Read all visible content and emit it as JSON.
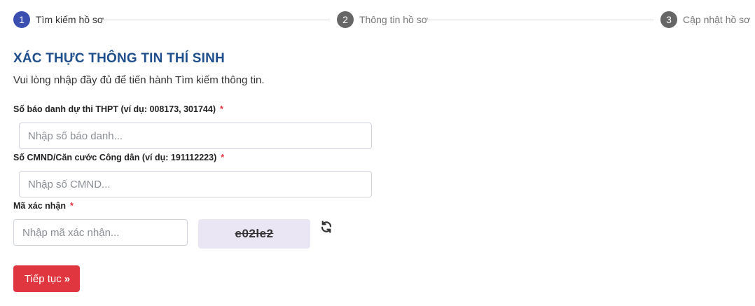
{
  "stepper": {
    "steps": [
      {
        "number": "1",
        "label": "Tìm kiếm hồ sơ"
      },
      {
        "number": "2",
        "label": "Thông tin hồ sơ"
      },
      {
        "number": "3",
        "label": "Cập nhật hồ sơ"
      }
    ],
    "active_color": "#3a4fb0",
    "inactive_color": "#666666"
  },
  "form": {
    "title": "XÁC THỰC THÔNG TIN THÍ SINH",
    "subtitle": "Vui lòng nhập đầy đủ để tiến hành Tìm kiếm thông tin.",
    "sbd": {
      "label": "Số báo danh dự thi THPT (ví dụ: 008173, 301744)",
      "required_mark": "*",
      "placeholder": "Nhập số báo danh..."
    },
    "cmnd": {
      "label": "Số CMND/Căn cước Công dân (ví dụ: 191112223)",
      "required_mark": "*",
      "placeholder": "Nhập số CMND..."
    },
    "captcha": {
      "label": "Mã xác nhận",
      "required_mark": "*",
      "placeholder": "Nhập mã xác nhận...",
      "code": "e02le2",
      "refresh_icon": "refresh-icon"
    },
    "submit": {
      "label": "Tiếp tục",
      "icon": "double-chevron-right-icon",
      "color": "#e0363f"
    }
  },
  "colors": {
    "title": "#1f4e8c",
    "required": "#e0333f"
  }
}
